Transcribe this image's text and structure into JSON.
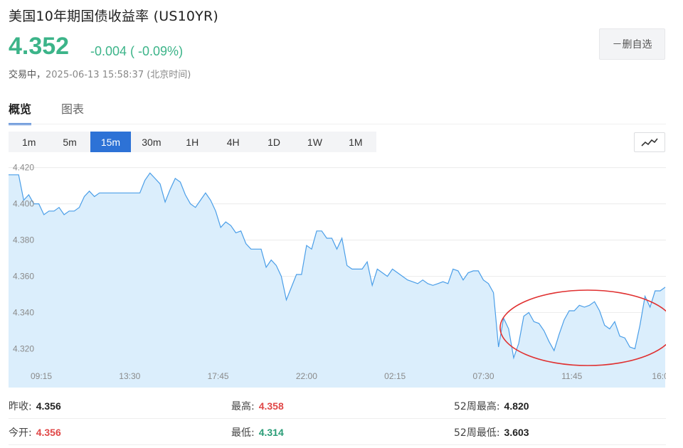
{
  "header": {
    "title": "美国10年期国债收益率 (US10YR)",
    "price": "4.352",
    "change": "-0.004 ( -0.09%)",
    "status_label": "交易中，",
    "timestamp": "2025-06-13 15:58:37 (北京时间)",
    "favorite_button": "－删自选"
  },
  "tabs": [
    {
      "label": "概览",
      "active": true
    },
    {
      "label": "图表",
      "active": false
    }
  ],
  "periods": [
    {
      "label": "1m",
      "active": false
    },
    {
      "label": "5m",
      "active": false
    },
    {
      "label": "15m",
      "active": true
    },
    {
      "label": "30m",
      "active": false
    },
    {
      "label": "1H",
      "active": false
    },
    {
      "label": "4H",
      "active": false
    },
    {
      "label": "1D",
      "active": false
    },
    {
      "label": "1W",
      "active": false
    },
    {
      "label": "1M",
      "active": false
    }
  ],
  "chart_type_icon": "line-chart-icon",
  "colors": {
    "up": "#3cb489",
    "line": "#4a9ee8",
    "fill": "#dbeefc",
    "accent": "#2d72d6",
    "annotation": "#e03030"
  },
  "chart_data": {
    "type": "area",
    "y_ticks": [
      "4.420",
      "4.400",
      "4.380",
      "4.360",
      "4.340",
      "4.320"
    ],
    "x_ticks": [
      "09:15",
      "13:30",
      "17:45",
      "22:00",
      "02:15",
      "07:30",
      "11:45",
      "16:0"
    ],
    "ylim": [
      4.31,
      4.423
    ],
    "grid": true,
    "annotation": "ellipse around the final section",
    "values": [
      4.416,
      4.416,
      4.416,
      4.402,
      4.405,
      4.4,
      4.4,
      4.394,
      4.396,
      4.396,
      4.398,
      4.394,
      4.396,
      4.396,
      4.398,
      4.404,
      4.407,
      4.404,
      4.406,
      4.406,
      4.406,
      4.406,
      4.406,
      4.406,
      4.406,
      4.406,
      4.406,
      4.413,
      4.417,
      4.414,
      4.411,
      4.401,
      4.408,
      4.414,
      4.412,
      4.405,
      4.4,
      4.398,
      4.402,
      4.406,
      4.402,
      4.396,
      4.387,
      4.39,
      4.388,
      4.384,
      4.385,
      4.378,
      4.375,
      4.375,
      4.375,
      4.365,
      4.369,
      4.366,
      4.36,
      4.347,
      4.354,
      4.361,
      4.361,
      4.377,
      4.375,
      4.385,
      4.385,
      4.381,
      4.381,
      4.375,
      4.381,
      4.366,
      4.364,
      4.364,
      4.364,
      4.368,
      4.355,
      4.364,
      4.362,
      4.36,
      4.364,
      4.362,
      4.36,
      4.358,
      4.357,
      4.356,
      4.358,
      4.356,
      4.355,
      4.356,
      4.357,
      4.356,
      4.364,
      4.363,
      4.358,
      4.362,
      4.363,
      4.363,
      4.358,
      4.356,
      4.351,
      4.321,
      4.337,
      4.331,
      4.315,
      4.323,
      4.338,
      4.34,
      4.335,
      4.334,
      4.33,
      4.324,
      4.319,
      4.328,
      4.336,
      4.341,
      4.341,
      4.344,
      4.343,
      4.344,
      4.346,
      4.341,
      4.333,
      4.331,
      4.335,
      4.327,
      4.326,
      4.321,
      4.32,
      4.333,
      4.349,
      4.343,
      4.352,
      4.352,
      4.354
    ]
  },
  "stats": {
    "prev_close_label": "昨收:",
    "prev_close": "4.356",
    "high_label": "最高:",
    "high": "4.358",
    "high52_label": "52周最高:",
    "high52": "4.820",
    "open_label": "今开:",
    "open": "4.356",
    "low_label": "最低:",
    "low": "4.314",
    "low52_label": "52周最低:",
    "low52": "3.603"
  }
}
